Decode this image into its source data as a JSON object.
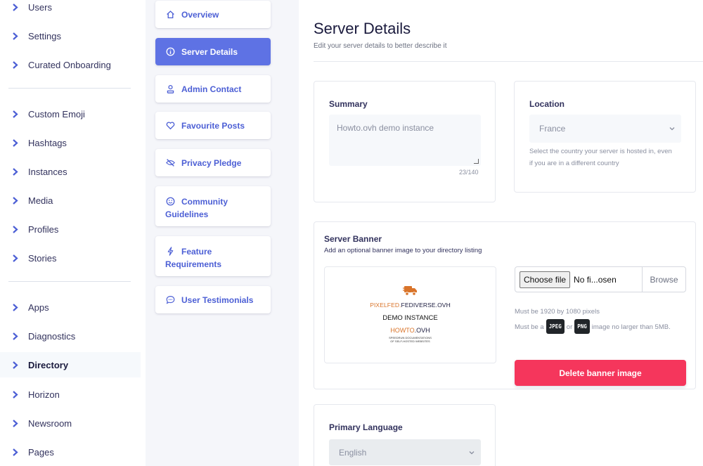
{
  "sidebar": {
    "items": [
      {
        "label": "Users"
      },
      {
        "label": "Settings"
      },
      {
        "label": "Curated Onboarding"
      },
      {
        "label": "Custom Emoji"
      },
      {
        "label": "Hashtags"
      },
      {
        "label": "Instances"
      },
      {
        "label": "Media"
      },
      {
        "label": "Profiles"
      },
      {
        "label": "Stories"
      },
      {
        "label": "Apps"
      },
      {
        "label": "Diagnostics"
      },
      {
        "label": "Directory"
      },
      {
        "label": "Horizon"
      },
      {
        "label": "Newsroom"
      },
      {
        "label": "Pages"
      }
    ],
    "active": "Directory"
  },
  "tabs": [
    {
      "label": "Overview",
      "icon": "home-icon"
    },
    {
      "label": "Server Details",
      "icon": "info-circle-icon"
    },
    {
      "label": "Admin Contact",
      "icon": "user-tie-icon"
    },
    {
      "label": "Favourite Posts",
      "icon": "heart-icon"
    },
    {
      "label": "Privacy Pledge",
      "icon": "eye-slash-icon"
    },
    {
      "label_line1": "Community",
      "label_line2": "Guidelines",
      "icon": "smile-icon"
    },
    {
      "label_line1": "Feature",
      "label_line2": "Requirements",
      "icon": "bolt-icon"
    },
    {
      "label": "User Testimonials",
      "icon": "comment-icon"
    }
  ],
  "main": {
    "title": "Server Details",
    "subtitle": "Edit your server details to better describe it",
    "summary": {
      "title": "Summary",
      "value": "Howto.ovh demo instance",
      "counter": "23/140"
    },
    "location": {
      "title": "Location",
      "selected": "France",
      "help_line1": "Select the country your server is hosted in, even",
      "help_line2": "if you are in a different country"
    },
    "banner": {
      "title": "Server Banner",
      "subtitle": "Add an optional banner image to your directory listing",
      "logo": {
        "line1_a": "PIXELFED.",
        "line1_b": "FEDIVERSE.OVH",
        "line2": "DEMO INSTANCE",
        "line3_a": "HOWTO",
        "line3_b": ".OVH",
        "line4": "SPEEDRUN DOCUMENTATIONS",
        "line5": "OF SELF-HOSTED WEBSITES"
      },
      "choose_file": "Choose file",
      "no_file": "No fi...osen",
      "browse": "Browse",
      "help_size": "Must be 1920 by 1080 pixels",
      "help_type_a": "Must be a",
      "help_type_jpeg": "JPEG",
      "help_type_or": "or",
      "help_type_png": "PNG",
      "help_type_b": "image no larger than 5MB.",
      "delete_label": "Delete banner image"
    },
    "language": {
      "title": "Primary Language",
      "selected": "English"
    }
  },
  "colors": {
    "accent": "#5e72e4",
    "danger": "#f5365c",
    "logo_orange": "#d9742a"
  }
}
